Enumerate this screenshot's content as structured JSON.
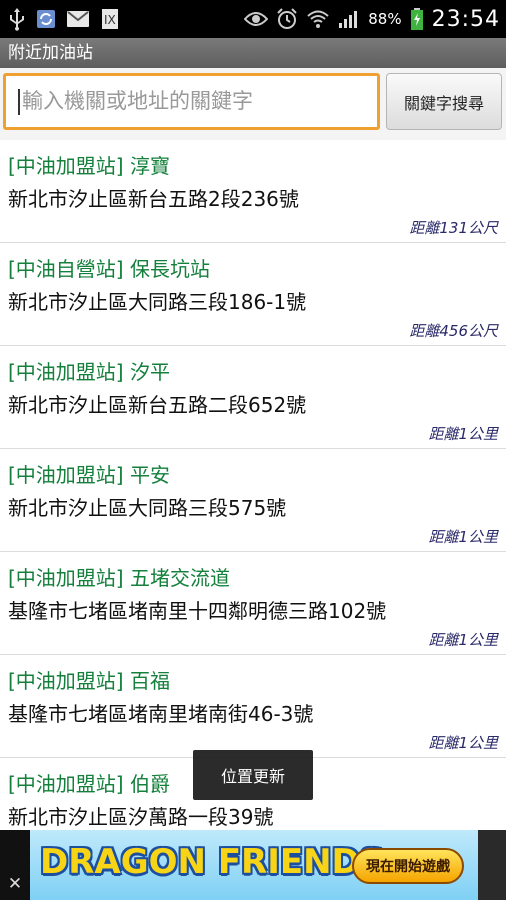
{
  "status_bar": {
    "battery": "88%",
    "time": "23:54",
    "icons": [
      "usb-icon",
      "sync-icon",
      "gmail-icon",
      "document-icon",
      "eye-icon",
      "alarm-icon",
      "wifi-icon",
      "signal-icon",
      "battery-icon"
    ]
  },
  "app": {
    "title": "附近加油站"
  },
  "search": {
    "placeholder": "輸入機關或地址的關鍵字",
    "button_label": "關鍵字搜尋"
  },
  "stations": [
    {
      "name": "[中油加盟站] 淳寶",
      "address": "新北市汐止區新台五路2段236號",
      "distance": "距離131公尺"
    },
    {
      "name": "[中油自營站] 保長坑站",
      "address": "新北市汐止區大同路三段186-1號",
      "distance": "距離456公尺"
    },
    {
      "name": "[中油加盟站] 汐平",
      "address": "新北市汐止區新台五路二段652號",
      "distance": "距離1公里"
    },
    {
      "name": "[中油加盟站] 平安",
      "address": "新北市汐止區大同路三段575號",
      "distance": "距離1公里"
    },
    {
      "name": "[中油加盟站] 五堵交流道",
      "address": "基隆市七堵區堵南里十四鄰明德三路102號",
      "distance": "距離1公里"
    },
    {
      "name": "[中油加盟站] 百福",
      "address": "基隆市七堵區堵南里堵南街46-3號",
      "distance": "距離1公里"
    },
    {
      "name": "[中油加盟站] 伯爵",
      "address": "新北市汐止區汐萬路一段39號",
      "distance": ""
    }
  ],
  "toast": {
    "text": "位置更新"
  },
  "ad": {
    "close_label": "✕",
    "title": "DRAGON FRIENDS",
    "cta": "現在開始遊戲"
  },
  "colors": {
    "station_name": "#14803c",
    "search_focus": "#f0a030",
    "title_bar": "#6b6b6b"
  }
}
